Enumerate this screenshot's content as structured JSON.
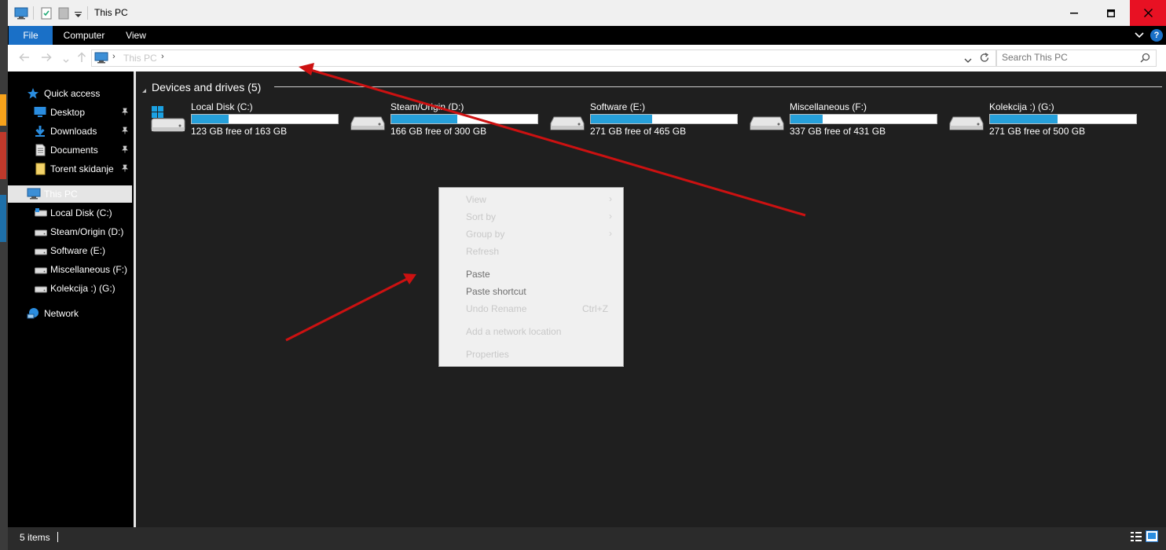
{
  "window": {
    "title": "This PC",
    "controls": [
      "minimize-icon",
      "maximize-icon",
      "close-icon"
    ]
  },
  "ribbon": {
    "tabs": [
      {
        "label": "File",
        "active": true
      },
      {
        "label": "Computer"
      },
      {
        "label": "View"
      }
    ],
    "help": "?"
  },
  "address": {
    "path": "This PC",
    "search_placeholder": "Search This PC"
  },
  "navigation": {
    "quick_access": {
      "label": "Quick access"
    },
    "pinned": [
      {
        "label": "Desktop",
        "icon": "desktop-folder-icon",
        "pinned": true
      },
      {
        "label": "Downloads",
        "icon": "downloads-folder-icon",
        "pinned": true
      },
      {
        "label": "Documents",
        "icon": "documents-folder-icon",
        "pinned": true
      },
      {
        "label": "Torent skidanje",
        "icon": "folder-icon",
        "pinned": true
      }
    ],
    "this_pc": {
      "label": "This PC",
      "selected": true
    },
    "drives": [
      {
        "label": "Local Disk (C:)"
      },
      {
        "label": "Steam/Origin (D:)"
      },
      {
        "label": "Software (E:)"
      },
      {
        "label": "Miscellaneous (F:)"
      },
      {
        "label": "Kolekcija :)  (G:)"
      }
    ],
    "network": {
      "label": "Network"
    }
  },
  "content": {
    "group_header": "Devices and drives (5)",
    "drives": [
      {
        "name": "Local Disk (C:)",
        "free": "123 GB free of 163 GB",
        "used_fraction": 0.25,
        "icon": "windows-drive-icon"
      },
      {
        "name": "Steam/Origin (D:)",
        "free": "166 GB free of 300 GB",
        "used_fraction": 0.45,
        "icon": "hard-drive-icon"
      },
      {
        "name": "Software (E:)",
        "free": "271 GB free of 465 GB",
        "used_fraction": 0.42,
        "icon": "hard-drive-icon"
      },
      {
        "name": "Miscellaneous (F:)",
        "free": "337 GB free of 431 GB",
        "used_fraction": 0.22,
        "icon": "hard-drive-icon"
      },
      {
        "name": "Kolekcija :)  (G:)",
        "free": "271 GB free of 500 GB",
        "used_fraction": 0.46,
        "icon": "hard-drive-icon"
      }
    ],
    "bar_color": "#26a0da"
  },
  "context_menu": {
    "items": [
      {
        "label": "View",
        "submenu": true,
        "enabled": false
      },
      {
        "label": "Sort by",
        "submenu": true,
        "enabled": false
      },
      {
        "label": "Group by",
        "submenu": true,
        "enabled": false
      },
      {
        "label": "Refresh",
        "enabled": false
      },
      {
        "label": "Paste",
        "enabled": true
      },
      {
        "label": "Paste shortcut",
        "enabled": true
      },
      {
        "label": "Undo Rename",
        "shortcut": "Ctrl+Z",
        "enabled": false
      },
      {
        "label": "Add a network location",
        "enabled": false
      },
      {
        "label": "Properties",
        "enabled": false
      }
    ]
  },
  "status": {
    "item_count": "5 items"
  },
  "annotation_color": "#cc1111"
}
